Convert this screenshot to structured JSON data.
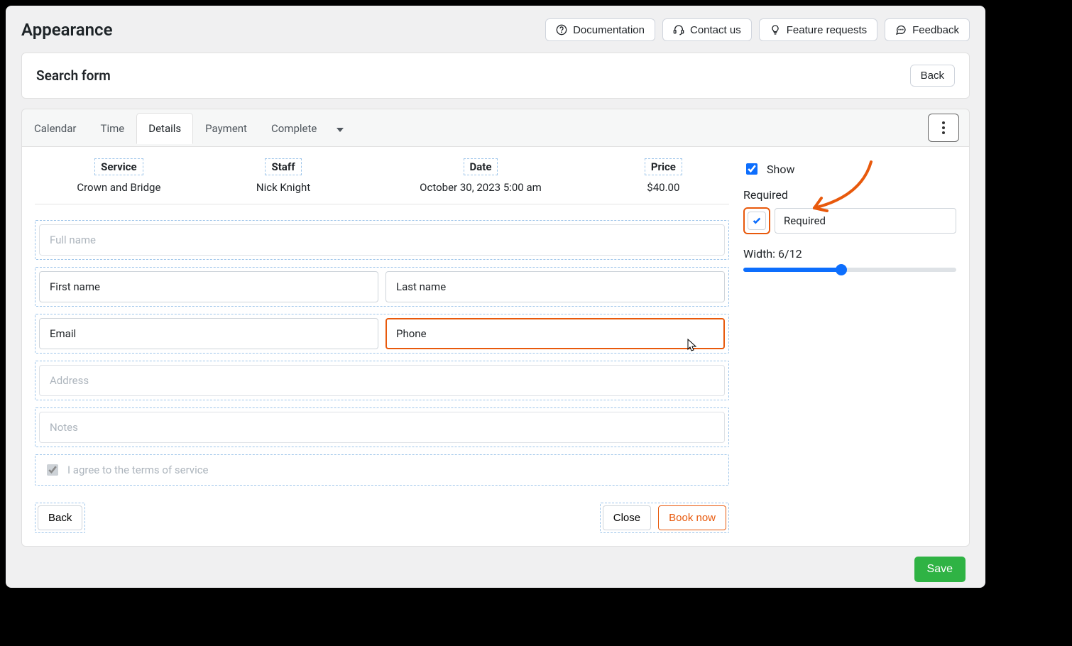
{
  "header": {
    "title": "Appearance",
    "buttons": {
      "documentation": "Documentation",
      "contact": "Contact us",
      "feature": "Feature requests",
      "feedback": "Feedback"
    }
  },
  "search_panel": {
    "title": "Search form",
    "back": "Back"
  },
  "tabs": {
    "calendar": "Calendar",
    "time": "Time",
    "details": "Details",
    "payment": "Payment",
    "complete": "Complete"
  },
  "summary": {
    "service_label": "Service",
    "service_value": "Crown and Bridge",
    "staff_label": "Staff",
    "staff_value": "Nick Knight",
    "date_label": "Date",
    "date_value": "October 30, 2023 5:00 am",
    "price_label": "Price",
    "price_value": "$40.00"
  },
  "fields": {
    "full_name": "Full name",
    "first_name": "First name",
    "last_name": "Last name",
    "email": "Email",
    "phone": "Phone",
    "address": "Address",
    "notes": "Notes",
    "terms": "I agree to the terms of service"
  },
  "form_buttons": {
    "back": "Back",
    "close": "Close",
    "book": "Book now"
  },
  "sidebar": {
    "show_label": "Show",
    "required_heading": "Required",
    "required_label": "Required",
    "width_label": "Width: 6/12"
  },
  "footer": {
    "save": "Save"
  }
}
